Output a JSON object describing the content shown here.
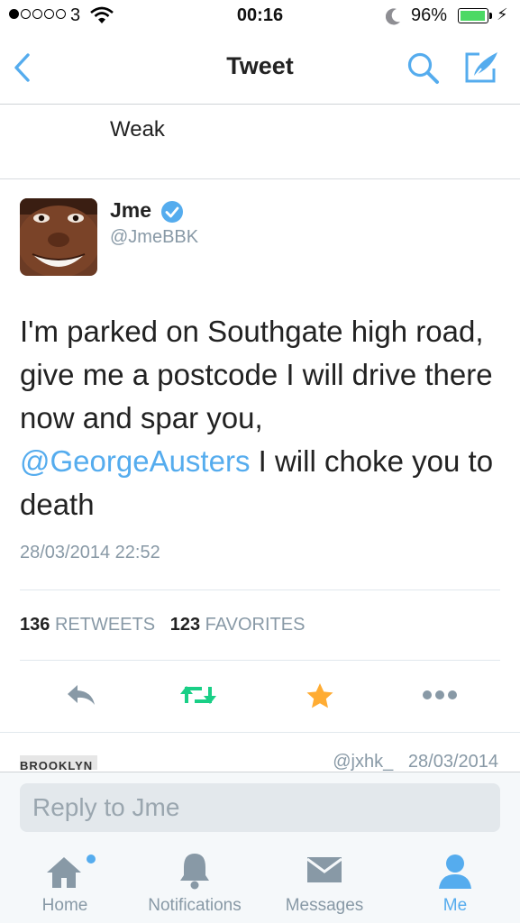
{
  "status_bar": {
    "signal_dots": [
      true,
      false,
      false,
      false,
      false
    ],
    "carrier": "3",
    "time": "00:16",
    "battery_percent": "96%",
    "battery_level": 0.96
  },
  "nav": {
    "title": "Tweet",
    "back_icon": "chevron-left-icon",
    "search_icon": "search-icon",
    "compose_icon": "compose-icon"
  },
  "previous_tweet": {
    "text": "Weak"
  },
  "tweet": {
    "author_name": "Jme",
    "author_handle": "@JmeBBK",
    "verified": true,
    "text_before": "I'm parked on Southgate high road, give me a postcode I will drive there now and spar you, ",
    "mention": "@GeorgeAusters",
    "text_after": " I will choke you to death",
    "timestamp": "28/03/2014 22:52",
    "retweets_count": "136",
    "retweets_label": "RETWEETS",
    "favorites_count": "123",
    "favorites_label": "FAVORITES"
  },
  "actions": [
    "reply-icon",
    "retweet-icon",
    "favorite-icon",
    "more-icon"
  ],
  "colors": {
    "accent": "#55acee",
    "retweet_green": "#19cf86",
    "favorite_gold": "#ffac33",
    "muted": "#8899a6"
  },
  "next_tweet": {
    "avatar_text": "BROOKLYN",
    "handle": "@jxhk_",
    "date": "28/03/2014"
  },
  "reply": {
    "placeholder": "Reply to Jme"
  },
  "tabs": [
    {
      "label": "Home",
      "icon": "home-icon",
      "has_dot": true
    },
    {
      "label": "Notifications",
      "icon": "bell-icon",
      "has_dot": false
    },
    {
      "label": "Messages",
      "icon": "envelope-icon",
      "has_dot": false
    },
    {
      "label": "Me",
      "icon": "person-icon",
      "active": true
    }
  ]
}
